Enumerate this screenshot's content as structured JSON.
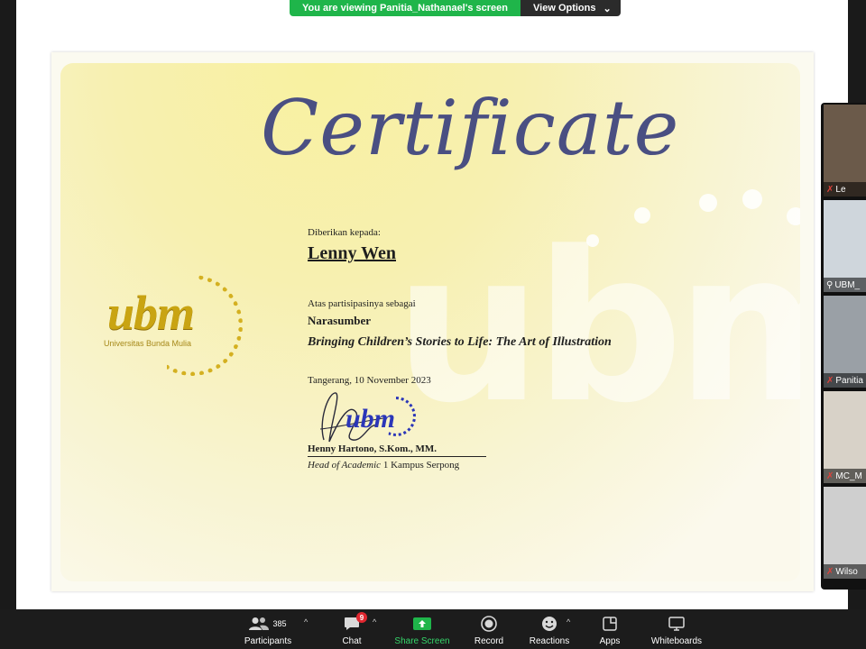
{
  "banner": {
    "viewing_text": "You are viewing Panitia_Nathanael's screen",
    "view_options_label": "View Options"
  },
  "certificate": {
    "title": "Certificate",
    "given_to_label": "Diberikan kepada:",
    "recipient_name": "Lenny Wen",
    "participation_label": "Atas partisipasinya sebagai",
    "role": "Narasumber",
    "event_title": "Bringing Children’s Stories to Life: The Art of Illustration",
    "place_date": "Tangerang, 10 November 2023",
    "signer_name": "Henny Hartono, S.Kom., MM.",
    "signer_title_italic": "Head of Academic",
    "signer_title_rest": " 1 Kampus Serpong",
    "logo_text": "ubm",
    "logo_subtext": "Universitas Bunda Mulia",
    "stamp_text": "ubm"
  },
  "participants_panel": [
    {
      "name": "Le",
      "bg": "#6b5a4a"
    },
    {
      "name": "UBM_",
      "bg": "#cfd6dc"
    },
    {
      "name": "Panitia",
      "bg": "#9aa0a6"
    },
    {
      "name": "MC_M",
      "bg": "#d8d2c8"
    },
    {
      "name": "Wilso",
      "bg": "#cfcfcf"
    }
  ],
  "toolbar": {
    "participants_label": "Participants",
    "participants_count": "385",
    "chat_label": "Chat",
    "chat_badge": "9",
    "share_label": "Share Screen",
    "record_label": "Record",
    "reactions_label": "Reactions",
    "apps_label": "Apps",
    "whiteboards_label": "Whiteboards"
  },
  "colors": {
    "banner_green": "#1fb54a",
    "share_green": "#1fb54a",
    "toolbar_bg": "#1c1c1c",
    "title_blue": "#4a4f82",
    "logo_gold": "#c9a412",
    "stamp_blue": "#2b36b8"
  }
}
